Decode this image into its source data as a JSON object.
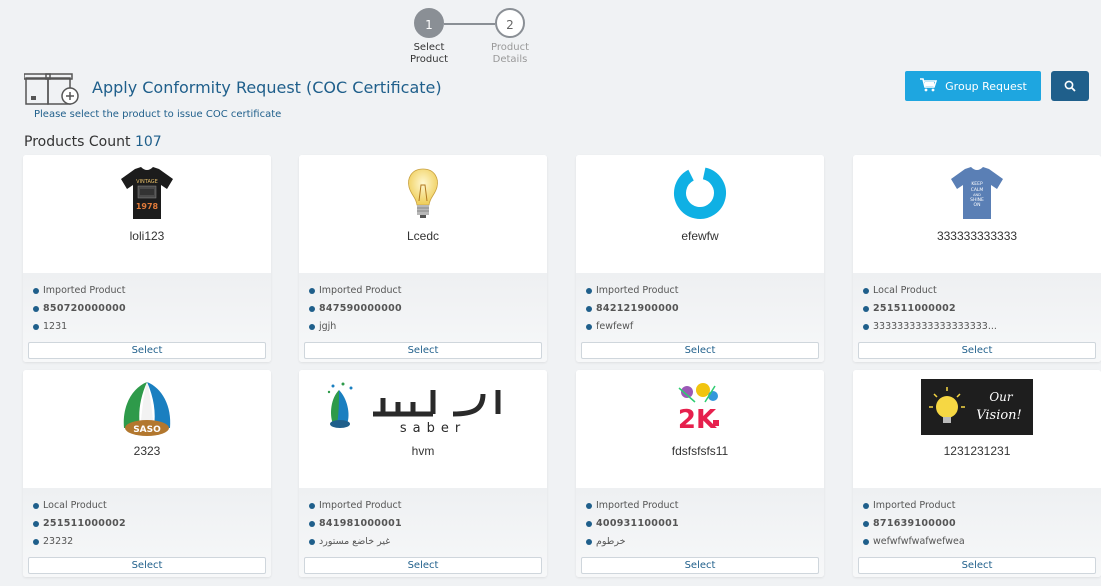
{
  "stepper": {
    "steps": [
      {
        "number": "1",
        "label_line1": "Select",
        "label_line2": "Product"
      },
      {
        "number": "2",
        "label_line1": "Product",
        "label_line2": "Details"
      }
    ]
  },
  "header": {
    "title": "Apply Conformity Request (COC Certificate)",
    "subtitle": "Please select the product to issue COC certificate",
    "group_request_label": "Group Request"
  },
  "products_count": {
    "label": "Products Count",
    "value": "107"
  },
  "colors": {
    "primary": "#1f5f8b",
    "accent": "#1ea6e0",
    "background": "#f0f2f4"
  },
  "products": [
    {
      "name": "loli123",
      "type": "Imported Product",
      "code": "850720000000",
      "extra": "1231",
      "select_label": "Select",
      "image": "vintage-tshirt-image",
      "image_text": "VINTAGE 1978"
    },
    {
      "name": "Lcedc",
      "type": "Imported Product",
      "code": "847590000000",
      "extra": "jgjh",
      "select_label": "Select",
      "image": "light-bulb-image"
    },
    {
      "name": "efewfw",
      "type": "Imported Product",
      "code": "842121900000",
      "extra": "fewfewf",
      "select_label": "Select",
      "image": "blue-ring-logo"
    },
    {
      "name": "333333333333",
      "type": "Local Product",
      "code": "251511000002",
      "extra": "3333333333333333333...",
      "select_label": "Select",
      "image": "keep-calm-tshirt-image",
      "image_text": "KEEP CALM AND SHINE ON"
    },
    {
      "name": "2323",
      "type": "Local Product",
      "code": "251511000002",
      "extra": "23232",
      "select_label": "Select",
      "image": "saso-logo",
      "image_text": "SASO"
    },
    {
      "name": "hvm",
      "type": "Imported Product",
      "code": "841981000001",
      "extra": "غير خاضع مستورد",
      "select_label": "Select",
      "image": "saber-logo",
      "image_text": "سابر saber"
    },
    {
      "name": "fdsfsfsfs11",
      "type": "Imported Product",
      "code": "400931100001",
      "extra": "خرطوم",
      "select_label": "Select",
      "image": "2k-logo",
      "image_text": "2K"
    },
    {
      "name": "1231231231",
      "type": "Imported Product",
      "code": "871639100000",
      "extra": "wefwfwfwafwefwea",
      "select_label": "Select",
      "image": "our-vision-image",
      "image_text": "Our Vision!"
    }
  ]
}
